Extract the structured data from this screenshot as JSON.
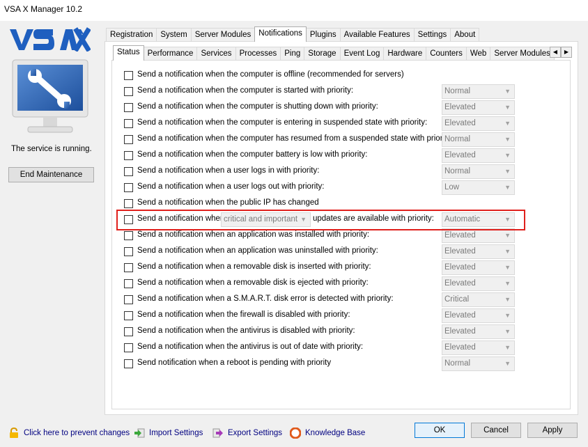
{
  "window": {
    "title": "VSA X Manager 10.2"
  },
  "left_panel": {
    "service_status": "The service is running.",
    "end_maintenance_label": "End Maintenance"
  },
  "main_tabs": [
    {
      "label": "Registration"
    },
    {
      "label": "System"
    },
    {
      "label": "Server Modules"
    },
    {
      "label": "Notifications",
      "active": true
    },
    {
      "label": "Plugins"
    },
    {
      "label": "Available Features"
    },
    {
      "label": "Settings"
    },
    {
      "label": "About"
    }
  ],
  "sub_tabs": [
    {
      "label": "Status",
      "active": true
    },
    {
      "label": "Performance"
    },
    {
      "label": "Services"
    },
    {
      "label": "Processes"
    },
    {
      "label": "Ping"
    },
    {
      "label": "Storage"
    },
    {
      "label": "Event Log"
    },
    {
      "label": "Hardware"
    },
    {
      "label": "Counters"
    },
    {
      "label": "Web"
    },
    {
      "label": "Server Modules"
    }
  ],
  "notifications": [
    {
      "label": "Send a notification when the computer is offline (recommended for servers)",
      "priority": ""
    },
    {
      "label": "Send a notification when the computer is started with priority:",
      "priority": "Normal"
    },
    {
      "label": "Send a notification when the computer is shutting down with priority:",
      "priority": "Elevated"
    },
    {
      "label": "Send a notification when the computer is entering in suspended state with priority:",
      "priority": "Elevated"
    },
    {
      "label": "Send a notification when the computer has resumed from a suspended state with priority:",
      "priority": "Normal"
    },
    {
      "label": "Send a notification when the computer battery is low with priority:",
      "priority": "Elevated"
    },
    {
      "label": "Send a notification when a user logs in with priority:",
      "priority": "Normal"
    },
    {
      "label": "Send a notification when a user logs out with priority:",
      "priority": "Low"
    },
    {
      "label": "Send a notification when the public IP has changed",
      "priority": ""
    },
    {
      "label": "Send a notification when",
      "update_type": "critical and important",
      "label_after": "updates are available with priority:",
      "priority": "Automatic",
      "highlighted": true
    },
    {
      "label": "Send a notification when an application was installed with priority:",
      "priority": "Elevated"
    },
    {
      "label": "Send a notification when an application was uninstalled with priority:",
      "priority": "Elevated"
    },
    {
      "label": "Send a notification when a removable disk is inserted with priority:",
      "priority": "Elevated"
    },
    {
      "label": "Send a notification when a removable disk is ejected with priority:",
      "priority": "Elevated"
    },
    {
      "label": "Send a notification when a S.M.A.R.T. disk error is detected with priority:",
      "priority": "Critical"
    },
    {
      "label": "Send a notification when the firewall is disabled with priority:",
      "priority": "Elevated"
    },
    {
      "label": "Send a notification when the antivirus is disabled with priority:",
      "priority": "Elevated"
    },
    {
      "label": "Send a notification when the antivirus is out of date with priority:",
      "priority": "Elevated"
    },
    {
      "label": "Send notification when a reboot is pending with priority",
      "priority": "Normal"
    }
  ],
  "bottom": {
    "prevent_changes": "Click here to prevent changes",
    "import_settings": "Import Settings",
    "export_settings": "Export Settings",
    "knowledge_base": "Knowledge Base",
    "ok": "OK",
    "cancel": "Cancel",
    "apply": "Apply"
  },
  "colors": {
    "highlight_border": "#e0201c",
    "logo_blue": "#1f5fbf",
    "link_color": "#000080"
  }
}
